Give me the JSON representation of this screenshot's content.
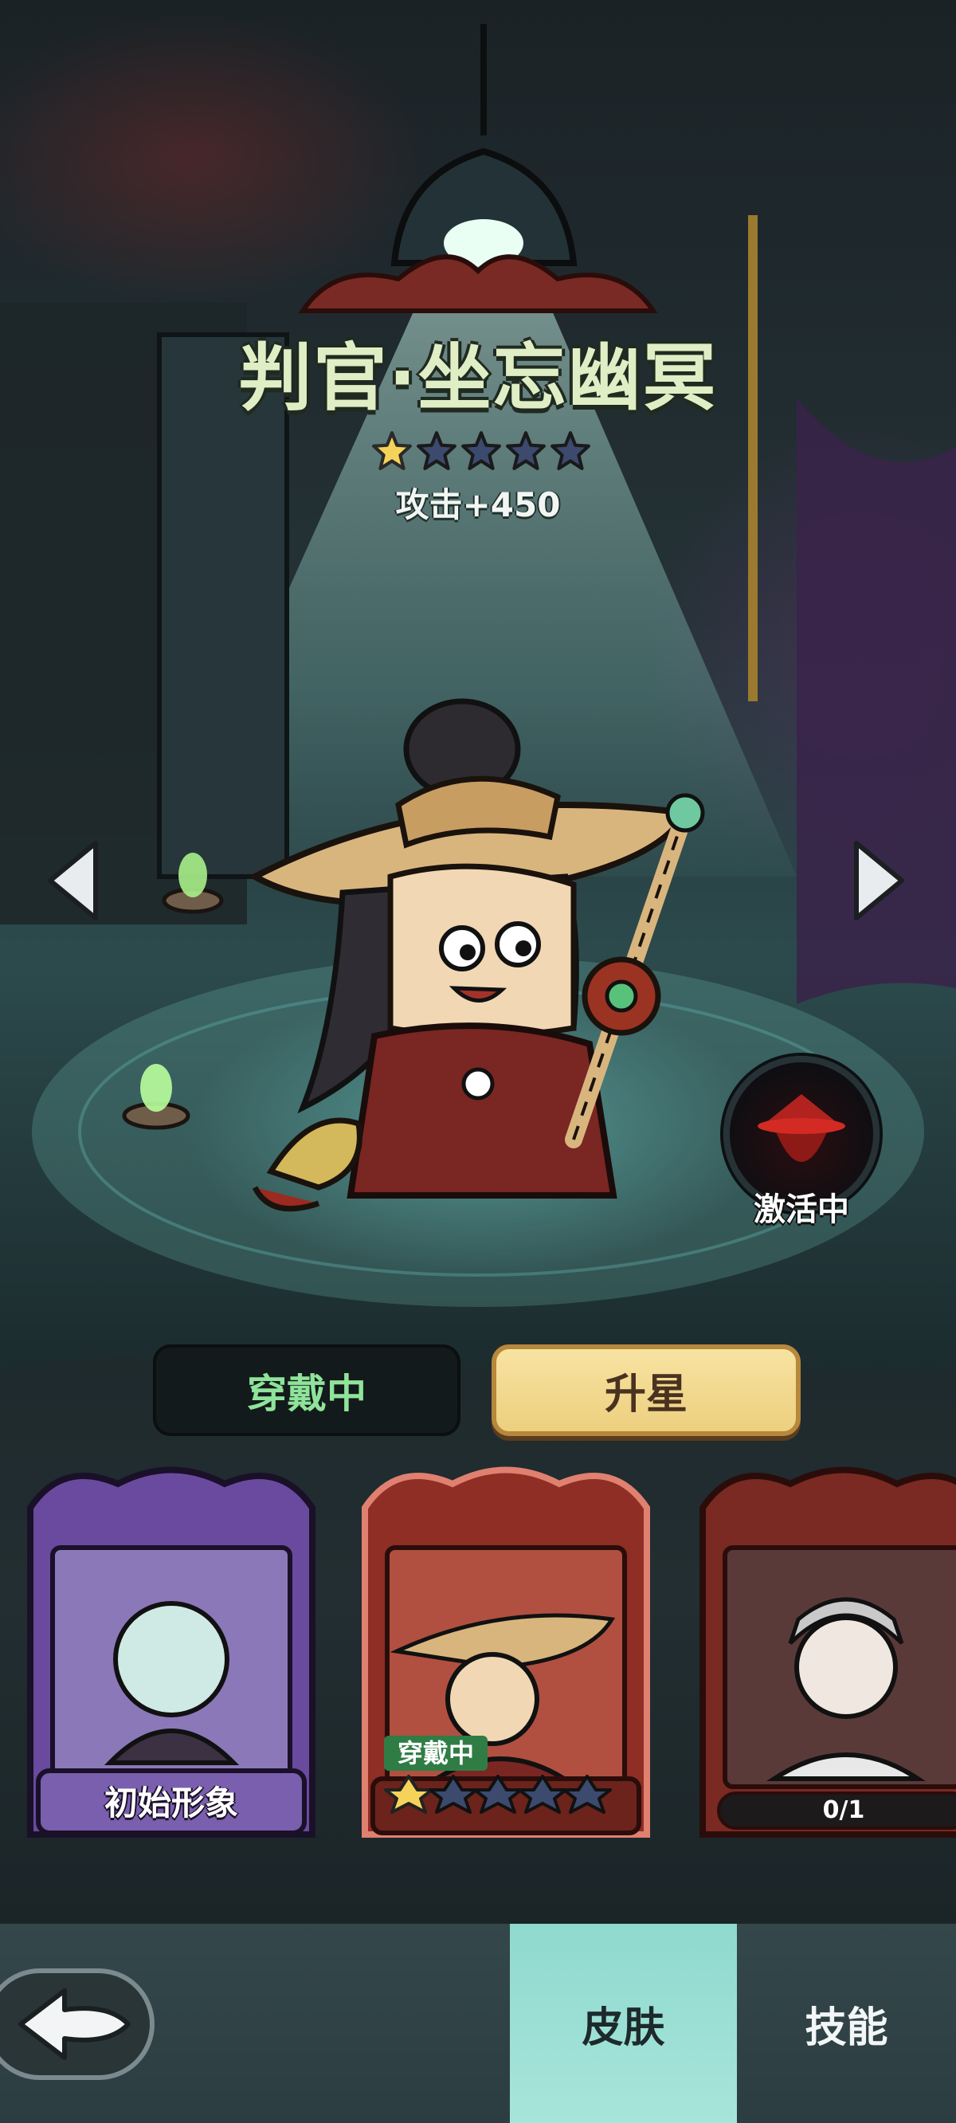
{
  "hero": {
    "name": "判官·坐忘幽冥",
    "stars_filled": 1,
    "stars_total": 5,
    "attack_text": "攻击+450"
  },
  "status": {
    "active_label": "激活中"
  },
  "actions": {
    "wearing_label": "穿戴中",
    "upgrade_label": "升星"
  },
  "skins": [
    {
      "label": "初始形象",
      "frame": "purple"
    },
    {
      "label": "穿戴中",
      "frame": "red",
      "stars_filled": 1,
      "stars_total": 5,
      "selected": true
    },
    {
      "label": "0/1",
      "frame": "red"
    }
  ],
  "tabs": {
    "skin_label": "皮肤",
    "skill_label": "技能"
  },
  "icons": {
    "prev": "triangle-left-icon",
    "next": "triangle-right-icon",
    "back": "back-arrow-icon"
  },
  "colors": {
    "title_fill": "#dfeec5",
    "wearing_text": "#8fe39a",
    "upgrade_bg": "#f0d68c",
    "skin_tab_bg": "#9fe0d6",
    "star_gold": "#f5d35a",
    "star_empty": "#3c4a6e"
  }
}
